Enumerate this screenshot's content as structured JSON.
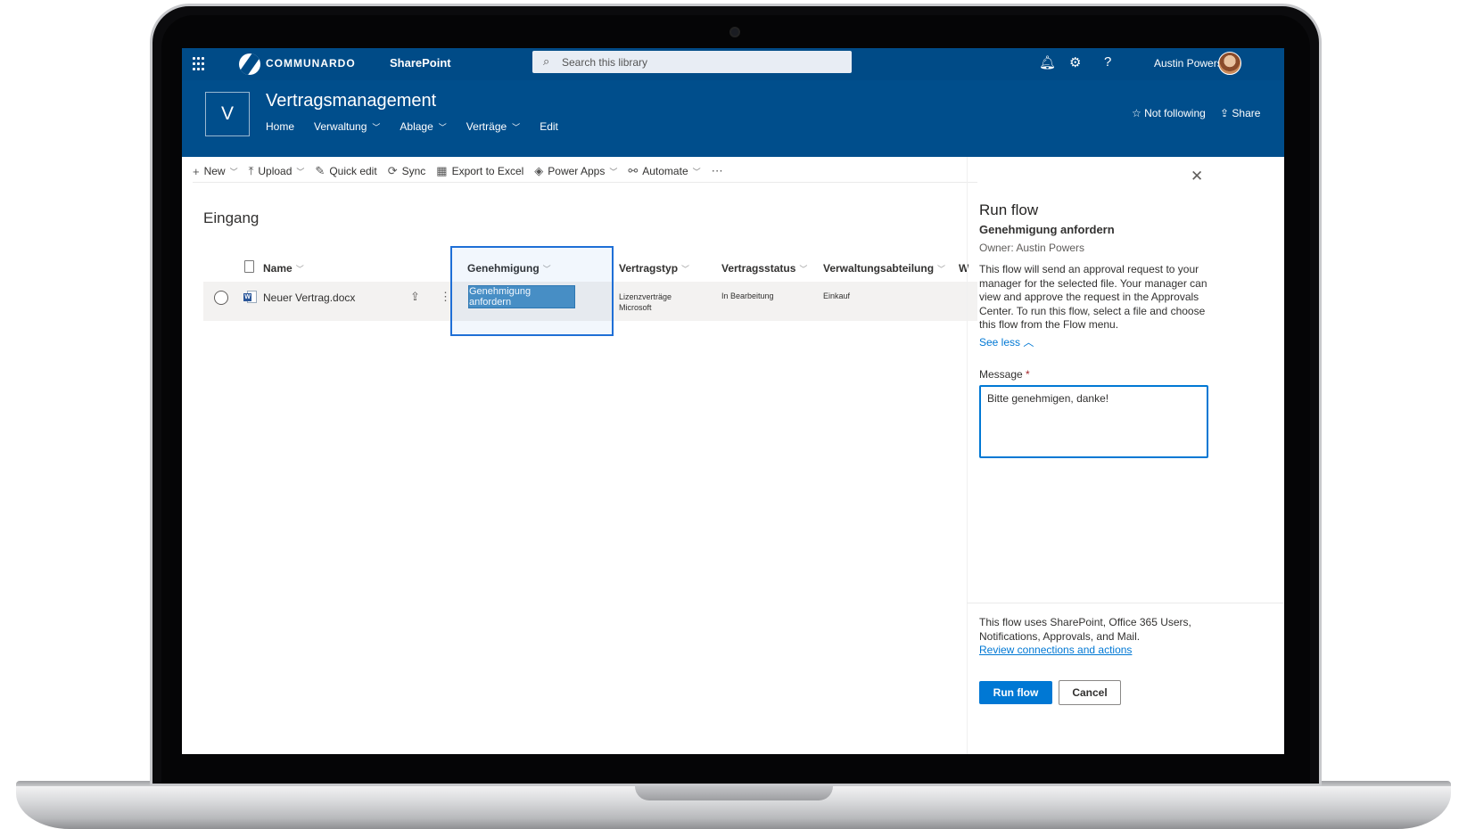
{
  "suite": {
    "brand": "COMMUNARDO",
    "app": "SharePoint",
    "search_placeholder": "Search this library",
    "user": "Austin Powers"
  },
  "site": {
    "logo_letter": "V",
    "title": "Vertragsmanagement",
    "nav": [
      "Home",
      "Verwaltung",
      "Ablage",
      "Verträge",
      "Edit"
    ],
    "follow": "Not following",
    "share": "Share"
  },
  "commands": [
    "New",
    "Upload",
    "Quick edit",
    "Sync",
    "Export to Excel",
    "Power Apps",
    "Automate"
  ],
  "library": {
    "title": "Eingang",
    "columns": [
      "Name",
      "Genehmigung",
      "Vertragstyp",
      "Vertragsstatus",
      "Verwaltungsabteilung",
      "Wi"
    ],
    "row": {
      "name": "Neuer Vertrag.docx",
      "approval_button": "Genehmigung anfordern",
      "vertragstyp_line1": "Lizenzverträge",
      "vertragstyp_line2": "Microsoft",
      "vertragsstatus": "In Bearbeitung",
      "abteilung": "Einkauf"
    }
  },
  "panel": {
    "title": "Run flow",
    "flow_name": "Genehmigung anfordern",
    "owner": "Owner: Austin Powers",
    "description": "This flow will send an approval request to your manager for the selected file. Your manager can view and approve the request in the Approvals Center. To run this flow, select a file and choose this flow from the Flow menu.",
    "see_less": "See less",
    "message_label": "Message",
    "required_mark": "*",
    "message_value": "Bitte genehmigen, danke!",
    "footer_text": "This flow uses SharePoint, Office 365 Users, Notifications, Approvals, and Mail.",
    "review_link": "Review connections and actions",
    "run_button": "Run flow",
    "cancel_button": "Cancel"
  },
  "colors": {
    "suite_bar": "#004b87",
    "site_header": "#004e8c",
    "accent": "#0078d4",
    "highlight": "#1f6fd6"
  }
}
